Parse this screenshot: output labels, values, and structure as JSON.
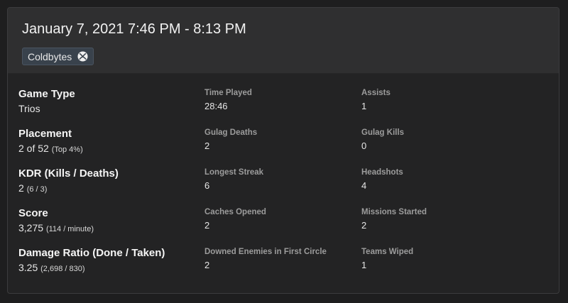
{
  "header": {
    "title": "January 7, 2021 7:46 PM - 8:13 PM",
    "player_chip": {
      "name": "Coldbytes",
      "icon": "xbox-icon"
    }
  },
  "primary_stats": [
    {
      "label": "Game Type",
      "value": "Trios",
      "detail": ""
    },
    {
      "label": "Placement",
      "value": "2 of 52",
      "detail": "(Top 4%)"
    },
    {
      "label": "KDR (Kills / Deaths)",
      "value": "2",
      "detail": "(6 / 3)"
    },
    {
      "label": "Score",
      "value": "3,275",
      "detail": "(114 / minute)"
    },
    {
      "label": "Damage Ratio (Done / Taken)",
      "value": "3.25",
      "detail": "(2,698 / 830)"
    }
  ],
  "secondary_col_a": [
    {
      "label": "Time Played",
      "value": "28:46"
    },
    {
      "label": "Gulag Deaths",
      "value": "2"
    },
    {
      "label": "Longest Streak",
      "value": "6"
    },
    {
      "label": "Caches Opened",
      "value": "2"
    },
    {
      "label": "Downed Enemies in First Circle",
      "value": "2"
    }
  ],
  "secondary_col_b": [
    {
      "label": "Assists",
      "value": "1"
    },
    {
      "label": "Gulag Kills",
      "value": "0"
    },
    {
      "label": "Headshots",
      "value": "4"
    },
    {
      "label": "Missions Started",
      "value": "2"
    },
    {
      "label": "Teams Wiped",
      "value": "1"
    }
  ]
}
